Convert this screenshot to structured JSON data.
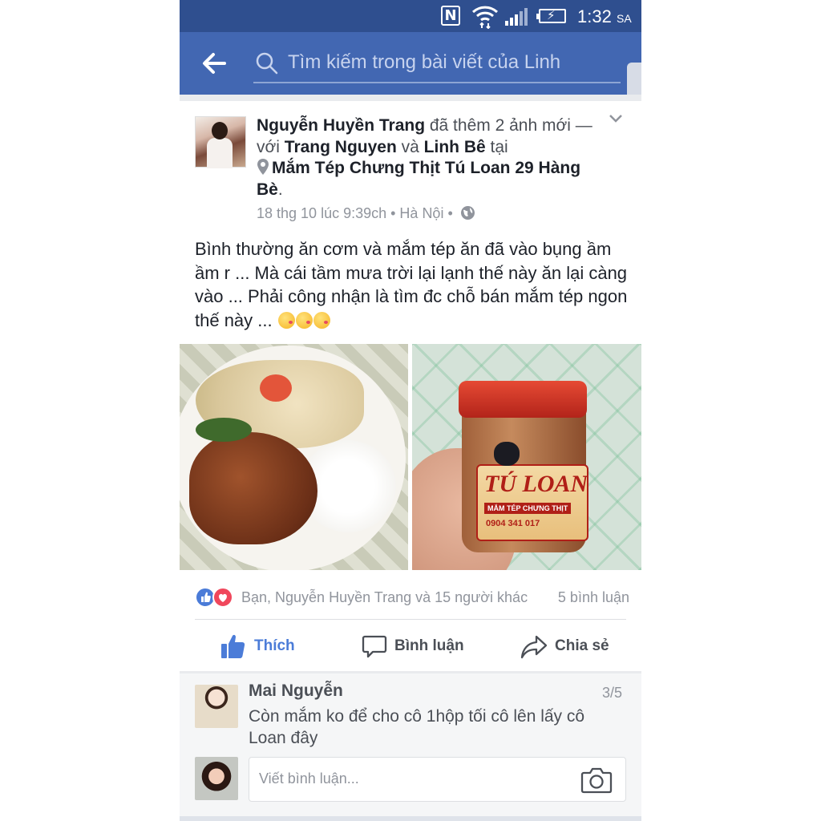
{
  "status_bar": {
    "nfc": "N",
    "time": "1:32",
    "ampm": "SA"
  },
  "header": {
    "search_placeholder": "Tìm kiếm trong bài viết của Linh"
  },
  "post": {
    "author": "Nguyễn Huyền Trang",
    "action_text_1": " đã thêm 2 ảnh mới — với ",
    "tagged_1": "Trang Nguyen",
    "and_text": " và ",
    "tagged_2": "Linh Bê",
    "at_text": " tại",
    "place": "Mắm Tép Chưng Thịt Tú Loan 29 Hàng Bè",
    "period": ".",
    "meta": "18 thg 10 lúc 9:39ch • Hà Nội •",
    "text": "Bình thường ăn cơm và mắm tép ăn đã vào bụng ầm ầm r ... Mà cái tầm mưa trời lại lạnh thế này ăn lại càng vào ... Phải công nhận là tìm đc chỗ bán mắm tép ngon thế này ...",
    "photo_label": {
      "brand": "TÚ LOAN",
      "subtitle": "MẮM TÉP CHƯNG THỊT",
      "phone": "0904 341 017"
    },
    "reactions": {
      "names": "Bạn, Nguyễn Huyền Trang và 15 người khác",
      "comment_count": "5 bình luận"
    },
    "actions": {
      "like": "Thích",
      "comment": "Bình luận",
      "share": "Chia sẻ"
    }
  },
  "comments": {
    "first": {
      "name": "Mai Nguyễn",
      "page": "3/5",
      "text": "Còn mắm ko để cho cô 1hộp tối cô lên lấy cô Loan đây"
    },
    "write_placeholder": "Viết bình luận..."
  },
  "colors": {
    "header": "#4267b2",
    "status_bar": "#2f4f8f",
    "link_blue": "#4b7cd8"
  }
}
